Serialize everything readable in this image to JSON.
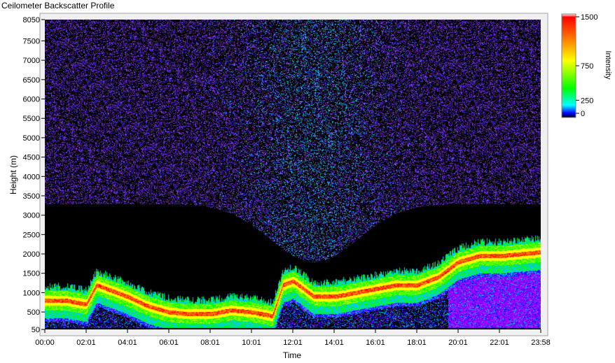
{
  "window": {
    "title": "Ceilometer Backscatter Profile"
  },
  "chart_data": {
    "type": "heatmap",
    "title": "Ceilometer Backscatter Profile",
    "xlabel": "Time",
    "ylabel": "Height (m)",
    "x_ticks": [
      "00:00",
      "02:01",
      "04:01",
      "06:01",
      "08:01",
      "10:01",
      "12:01",
      "14:01",
      "16:01",
      "18:01",
      "20:01",
      "22:01",
      "23:58"
    ],
    "y_ticks": [
      50,
      500,
      1000,
      1500,
      2000,
      2500,
      3000,
      3500,
      4000,
      4500,
      5000,
      5500,
      6000,
      6500,
      7000,
      7500,
      8050
    ],
    "ylim": [
      50,
      8050
    ],
    "xlim_hours": [
      0,
      23.97
    ],
    "colorbar": {
      "label": "Intensity",
      "ticks": [
        0,
        250,
        750,
        1500
      ],
      "range": [
        0,
        1500
      ],
      "colors": [
        "#000000",
        "#0000ff",
        "#00ffff",
        "#00ff00",
        "#ffff00",
        "#ff8000",
        "#ff0000",
        "#ffffff"
      ]
    },
    "boundary_layer": {
      "time_hours": [
        0,
        1,
        2,
        2.5,
        3,
        4,
        5,
        6,
        7,
        8,
        9,
        10,
        11,
        11.5,
        12,
        13,
        14,
        15,
        16,
        17,
        18,
        19,
        20,
        21,
        22,
        23,
        23.97
      ],
      "height_m": [
        800,
        800,
        700,
        1200,
        1100,
        900,
        650,
        500,
        450,
        450,
        550,
        500,
        400,
        1200,
        1300,
        900,
        900,
        1000,
        1100,
        1200,
        1200,
        1400,
        1800,
        1950,
        1950,
        2000,
        2050
      ]
    }
  }
}
